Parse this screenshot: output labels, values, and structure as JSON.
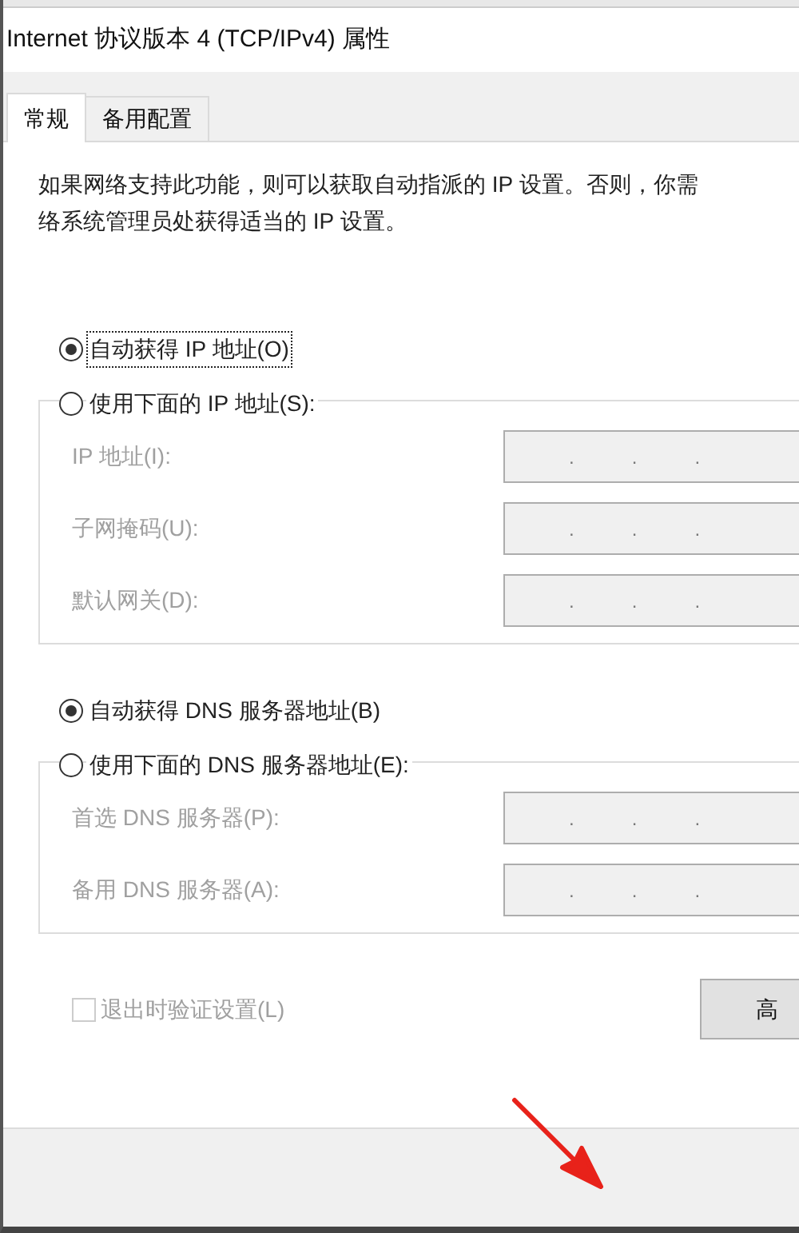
{
  "window": {
    "title": "Internet 协议版本 4 (TCP/IPv4) 属性"
  },
  "tabs": [
    {
      "label": "常规",
      "selected": true
    },
    {
      "label": "备用配置",
      "selected": false
    }
  ],
  "description": [
    "如果网络支持此功能，则可以获取自动指派的 IP 设置。否则，你需",
    "络系统管理员处获得适当的 IP 设置。"
  ],
  "sections": [
    {
      "auto_option": {
        "label": "自动获得 IP 地址(O)",
        "selected": true,
        "focused": true
      },
      "manual_option": {
        "label": "使用下面的 IP 地址(S):",
        "selected": false
      },
      "fields": [
        {
          "label": "IP 地址(I):",
          "disabled": true,
          "separators": [
            ".",
            ".",
            "."
          ]
        },
        {
          "label": "子网掩码(U):",
          "disabled": true,
          "separators": [
            ".",
            ".",
            "."
          ]
        },
        {
          "label": "默认网关(D):",
          "disabled": true,
          "separators": [
            ".",
            ".",
            "."
          ]
        }
      ]
    },
    {
      "auto_option": {
        "label": "自动获得 DNS 服务器地址(B)",
        "selected": true,
        "focused": false
      },
      "manual_option": {
        "label": "使用下面的 DNS 服务器地址(E):",
        "selected": false
      },
      "fields": [
        {
          "label": "首选 DNS 服务器(P):",
          "disabled": true,
          "separators": [
            ".",
            ".",
            "."
          ]
        },
        {
          "label": "备用 DNS 服务器(A):",
          "disabled": true,
          "separators": [
            ".",
            ".",
            "."
          ]
        }
      ]
    }
  ],
  "validate_checkbox": {
    "label": "退出时验证设置(L)",
    "checked": false,
    "disabled": true
  },
  "advanced_button": {
    "label": "高"
  }
}
